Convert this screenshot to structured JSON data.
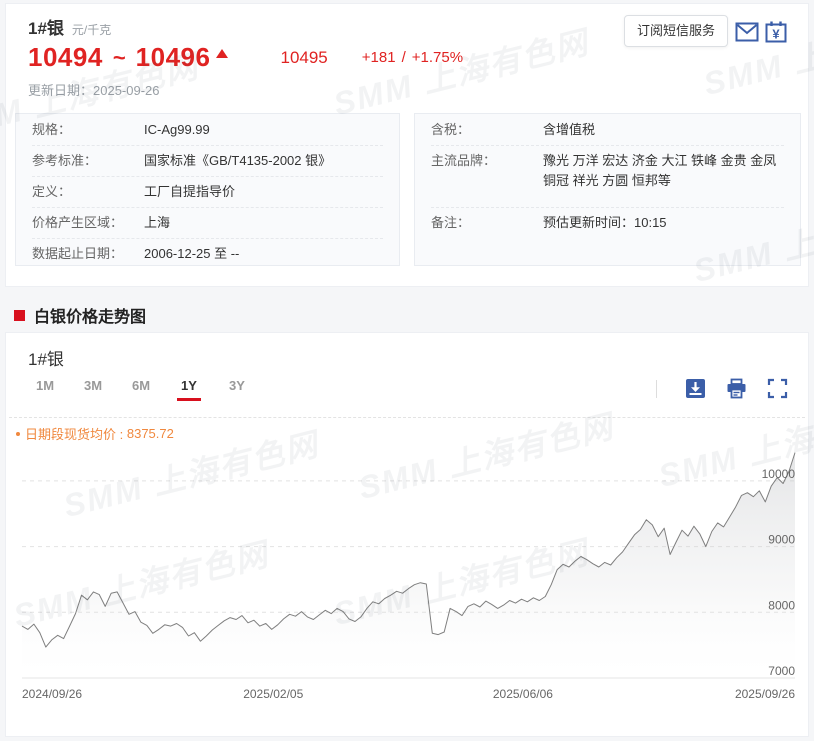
{
  "watermark": "SMM 上海有色网",
  "header": {
    "product": "1#银",
    "unit": "元/千克",
    "price_range": {
      "low": "10494",
      "tilde": "~",
      "high": "10496"
    },
    "avg": "10495",
    "change": "+181",
    "slash": "/",
    "change_pct": "+1.75%",
    "update_label": "更新日期：",
    "update_date": "2025-09-26",
    "subscribe_button": "订阅短信服务",
    "icons": {
      "mail": "mail-icon",
      "price_calendar": "price-calendar-icon"
    }
  },
  "info_left": {
    "rows": [
      {
        "label": "规格：",
        "value": "IC-Ag99.99"
      },
      {
        "label": "参考标准：",
        "value": "国家标准《GB/T4135-2002 银》"
      },
      {
        "label": "定义：",
        "value": "工厂自提指导价"
      },
      {
        "label": "价格产生区域：",
        "value": "上海"
      },
      {
        "label": "数据起止日期：",
        "value": "2006-12-25 至 --"
      }
    ]
  },
  "info_right": {
    "rows": [
      {
        "label": "含税：",
        "value": "含增值税"
      },
      {
        "label": "主流品牌：",
        "value": "豫光 万洋 宏达 济金 大江 铁峰 金贵 金凤 铜冠 祥光 方圆 恒邦等"
      },
      {
        "label": "备注：",
        "value": "预估更新时间：10:15"
      }
    ]
  },
  "section_title": "白银价格走势图",
  "chart": {
    "title": "1#银",
    "tabs": [
      {
        "label": "1M",
        "active": false
      },
      {
        "label": "3M",
        "active": false
      },
      {
        "label": "6M",
        "active": false
      },
      {
        "label": "1Y",
        "active": true
      },
      {
        "label": "3Y",
        "active": false
      }
    ],
    "toolbar_icons": [
      "save-image-icon",
      "print-icon",
      "fullscreen-icon"
    ],
    "avg_label": "日期段现货均价 :",
    "avg_value": "8375.72",
    "chart_data": {
      "type": "area",
      "title": "1#银",
      "legend": [],
      "grid": "horizontal-dashed",
      "y_axis_side": "right",
      "y_min": 7000,
      "y_ticks": [
        7000,
        8000,
        9000,
        10000
      ],
      "x_ticks": [
        {
          "label": "2024/09/26",
          "pos": 0
        },
        {
          "label": "2025/02/05",
          "pos": 0.325
        },
        {
          "label": "2025/06/06",
          "pos": 0.648
        },
        {
          "label": "2025/09/26",
          "pos": 1
        }
      ],
      "period_avg": 8375.72,
      "values": [
        7790,
        7740,
        7820,
        7690,
        7470,
        7580,
        7650,
        7600,
        7790,
        7980,
        8260,
        8190,
        8310,
        8270,
        8090,
        8290,
        8310,
        8140,
        7970,
        8010,
        7850,
        7800,
        7680,
        7740,
        7810,
        7790,
        7830,
        7770,
        7640,
        7690,
        7560,
        7640,
        7730,
        7800,
        7870,
        7920,
        7890,
        7950,
        7840,
        7880,
        7790,
        7830,
        7740,
        7810,
        7900,
        7970,
        7940,
        8010,
        7930,
        7890,
        7960,
        8030,
        7980,
        8060,
        8010,
        7900,
        7860,
        7930,
        8060,
        8160,
        8130,
        8210,
        8260,
        8320,
        8290,
        8360,
        8420,
        8450,
        8430,
        7680,
        7660,
        7700,
        8060,
        8010,
        7950,
        8090,
        8130,
        8080,
        8170,
        8120,
        8060,
        8110,
        8180,
        8140,
        8200,
        8160,
        8220,
        8180,
        8240,
        8420,
        8650,
        8730,
        8690,
        8780,
        8850,
        8800,
        8740,
        8690,
        8760,
        8720,
        8830,
        8920,
        9050,
        9180,
        9260,
        9410,
        9330,
        9150,
        9280,
        8880,
        9070,
        9250,
        9160,
        9310,
        9190,
        9000,
        9230,
        9360,
        9300,
        9450,
        9600,
        9780,
        9820,
        9760,
        9850,
        9680,
        9920,
        10050,
        9960,
        10150,
        10430
      ]
    }
  },
  "colors": {
    "brand_red": "#d8101e",
    "price_red": "#e02322",
    "icon_blue": "#3b5ea8",
    "avg_orange": "#f0883e",
    "line_gray": "#808080"
  }
}
